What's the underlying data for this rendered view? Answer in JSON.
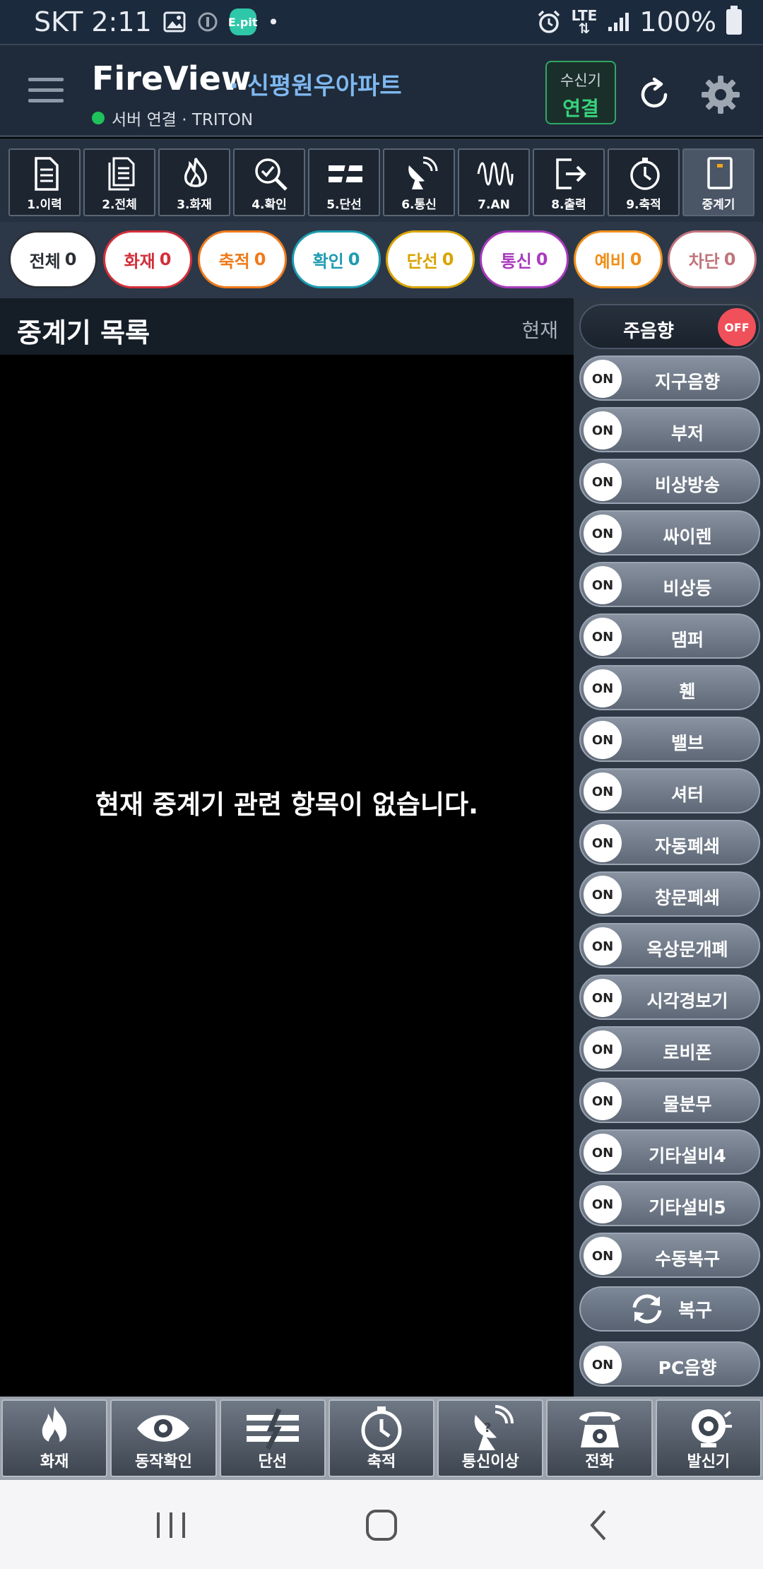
{
  "status_bar": {
    "carrier_time": "SKT 2:11",
    "epit": "E.pit",
    "lte": "LTE",
    "battery": "100%"
  },
  "header": {
    "title": "FireView",
    "site": "· 신평원우아파트",
    "connection": "서버 연결 · TRITON",
    "receiver_label": "수신기",
    "receiver_status": "연결"
  },
  "toolbar": [
    {
      "label": "1.이력",
      "icon": "document-icon"
    },
    {
      "label": "2.전체",
      "icon": "documents-icon"
    },
    {
      "label": "3.화재",
      "icon": "fire-icon"
    },
    {
      "label": "4.확인",
      "icon": "check-search-icon"
    },
    {
      "label": "5.단선",
      "icon": "broken-line-icon"
    },
    {
      "label": "6.통신",
      "icon": "satellite-icon"
    },
    {
      "label": "7.AN",
      "icon": "wave-icon"
    },
    {
      "label": "8.출력",
      "icon": "exit-icon"
    },
    {
      "label": "9.축적",
      "icon": "timer-icon"
    },
    {
      "label": "중계기",
      "icon": "relay-icon"
    }
  ],
  "chips": [
    {
      "label": "전체",
      "count": "0",
      "color": "#2b2f36"
    },
    {
      "label": "화재",
      "count": "0",
      "color": "#d32f3a"
    },
    {
      "label": "축적",
      "count": "0",
      "color": "#ef7a1a"
    },
    {
      "label": "확인",
      "count": "0",
      "color": "#1d9bb0"
    },
    {
      "label": "단선",
      "count": "0",
      "color": "#d9a400"
    },
    {
      "label": "통신",
      "count": "0",
      "color": "#a93bbd"
    },
    {
      "label": "예비",
      "count": "0",
      "color": "#ef8f1a"
    },
    {
      "label": "차단",
      "count": "0",
      "color": "#c0747c"
    }
  ],
  "content": {
    "title": "중계기 목록",
    "subtitle": "현재",
    "empty_message": "현재 중계기 관련 항목이 없습니다."
  },
  "panel": {
    "main_sound": {
      "label": "주음향",
      "state": "OFF"
    },
    "toggles": [
      {
        "label": "지구음향",
        "state": "ON"
      },
      {
        "label": "부저",
        "state": "ON"
      },
      {
        "label": "비상방송",
        "state": "ON"
      },
      {
        "label": "싸이렌",
        "state": "ON"
      },
      {
        "label": "비상등",
        "state": "ON"
      },
      {
        "label": "댐퍼",
        "state": "ON"
      },
      {
        "label": "휀",
        "state": "ON"
      },
      {
        "label": "밸브",
        "state": "ON"
      },
      {
        "label": "셔터",
        "state": "ON"
      },
      {
        "label": "자동폐쇄",
        "state": "ON"
      },
      {
        "label": "창문폐쇄",
        "state": "ON"
      },
      {
        "label": "옥상문개폐",
        "state": "ON"
      },
      {
        "label": "시각경보기",
        "state": "ON"
      },
      {
        "label": "로비폰",
        "state": "ON"
      },
      {
        "label": "물분무",
        "state": "ON"
      },
      {
        "label": "기타설비4",
        "state": "ON"
      },
      {
        "label": "기타설비5",
        "state": "ON"
      },
      {
        "label": "수동복구",
        "state": "ON"
      }
    ],
    "recover": {
      "label": "복구"
    },
    "pc_sound": {
      "label": "PC음향",
      "state": "ON"
    }
  },
  "bottom_nav": [
    {
      "label": "화재",
      "icon": "fire-icon"
    },
    {
      "label": "동작확인",
      "icon": "eye-icon"
    },
    {
      "label": "단선",
      "icon": "broken-line-icon"
    },
    {
      "label": "축적",
      "icon": "timer-icon"
    },
    {
      "label": "통신이상",
      "icon": "satellite-icon"
    },
    {
      "label": "전화",
      "icon": "phone-icon"
    },
    {
      "label": "발신기",
      "icon": "bell-icon"
    }
  ]
}
